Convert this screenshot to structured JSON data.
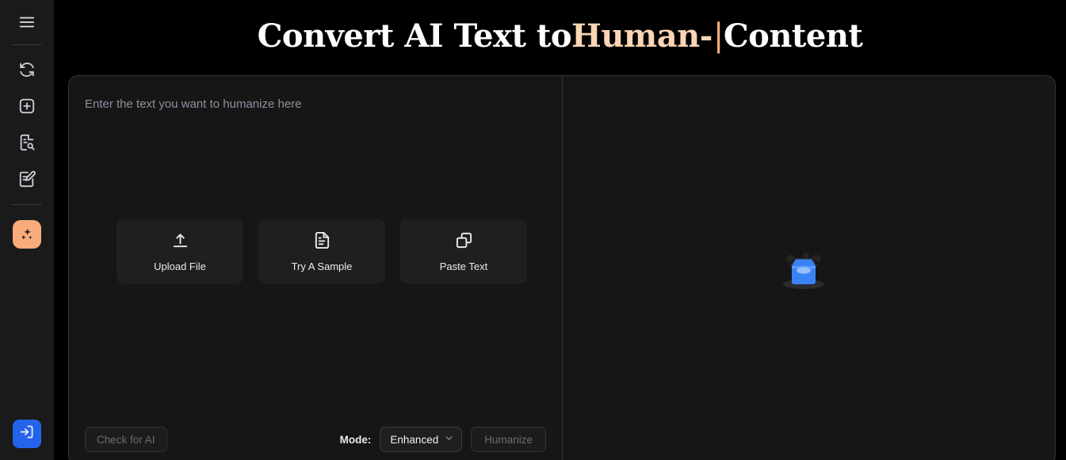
{
  "header": {
    "title_prefix": "Convert AI Text to ",
    "title_highlight": "Human-",
    "title_caret": "|",
    "title_suffix": " Content",
    "highlight_color": "#fbd5b5",
    "caret_color": "#f9ab7b"
  },
  "sidebar": {
    "menu_toggle": {
      "icon": "hamburger-menu-icon"
    },
    "items": [
      {
        "icon": "refresh-cycle-icon",
        "name": "sidebar-item-rewrite"
      },
      {
        "icon": "plus-square-icon",
        "name": "sidebar-item-new"
      },
      {
        "icon": "document-search-icon",
        "name": "sidebar-item-detector"
      },
      {
        "icon": "document-edit-icon",
        "name": "sidebar-item-editor"
      }
    ],
    "active_item": {
      "icon": "sparkles-icon",
      "name": "sidebar-item-humanizer",
      "bg_color": "#f9ab7b"
    },
    "login": {
      "icon": "login-arrow-icon",
      "name": "login-button",
      "bg_color": "#2563eb"
    }
  },
  "editor": {
    "placeholder": "Enter the text you want to humanize here",
    "value": ""
  },
  "quick_actions": [
    {
      "label": "Upload File",
      "icon": "upload-arrow-icon",
      "name": "upload-file-button"
    },
    {
      "label": "Try A Sample",
      "icon": "document-lines-icon",
      "name": "try-a-sample-button"
    },
    {
      "label": "Paste Text",
      "icon": "copy-paste-icon",
      "name": "paste-text-button"
    }
  ],
  "toolbar": {
    "check_ai_label": "Check for AI",
    "mode_label": "Mode:",
    "mode_value": "Enhanced",
    "mode_options": [
      "Enhanced"
    ],
    "humanize_label": "Humanize"
  },
  "output": {
    "empty_illustration": "empty-box-icon",
    "illustration_color": "#3b82f6",
    "text": ""
  },
  "theme": {
    "page_background": "#000000",
    "panel_background": "#161616",
    "sidebar_background": "#1a1a1a",
    "border_color": "#343434"
  }
}
